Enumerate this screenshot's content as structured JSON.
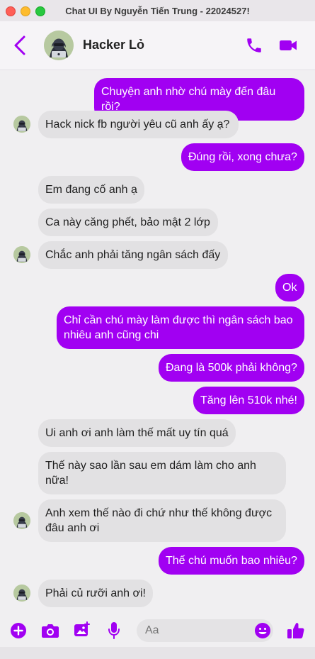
{
  "window": {
    "title": "Chat UI By Nguyễn Tiến Trung - 22024527!"
  },
  "header": {
    "contact_name": "Hacker Lỏ"
  },
  "messages": [
    {
      "dir": "out",
      "text": "Chuyện anh nhờ chú mày đến đâu rồi?"
    },
    {
      "dir": "in",
      "text": "Hack nick fb người yêu cũ anh ấy ạ?"
    },
    {
      "dir": "out",
      "text": "Đúng rồi, xong chưa?"
    },
    {
      "dir": "in",
      "text": "Em đang cố anh ạ"
    },
    {
      "dir": "in",
      "text": "Ca này căng phết, bảo mật 2 lớp"
    },
    {
      "dir": "in",
      "text": "Chắc anh phải tăng ngân sách đấy"
    },
    {
      "dir": "out",
      "text": "Ok"
    },
    {
      "dir": "out",
      "text": "Chỉ cần chú mày làm được thì ngân sách bao nhiêu anh cũng chi"
    },
    {
      "dir": "out",
      "text": "Đang là 500k phải không?"
    },
    {
      "dir": "out",
      "text": "Tăng lên 510k nhé!"
    },
    {
      "dir": "in",
      "text": "Ui anh ơi anh làm thế mất uy tín quá"
    },
    {
      "dir": "in",
      "text": "Thế này sao lần sau em dám làm cho anh nữa!"
    },
    {
      "dir": "in",
      "text": "Anh xem thế nào đi chứ như thế không được đâu anh ơi"
    },
    {
      "dir": "out",
      "text": "Thế chú muốn bao nhiêu?"
    },
    {
      "dir": "in",
      "text": "Phải củ rưỡi anh ơi!"
    }
  ],
  "composer": {
    "placeholder": "Aa"
  },
  "colors": {
    "accent": "#a100f2",
    "incoming_bubble": "#e2e1e3",
    "background": "#f0eff1"
  },
  "icons": [
    "back-icon",
    "phone-icon",
    "video-icon",
    "plus-icon",
    "camera-icon",
    "image-icon",
    "microphone-icon",
    "emoji-icon",
    "thumbs-up-icon"
  ]
}
